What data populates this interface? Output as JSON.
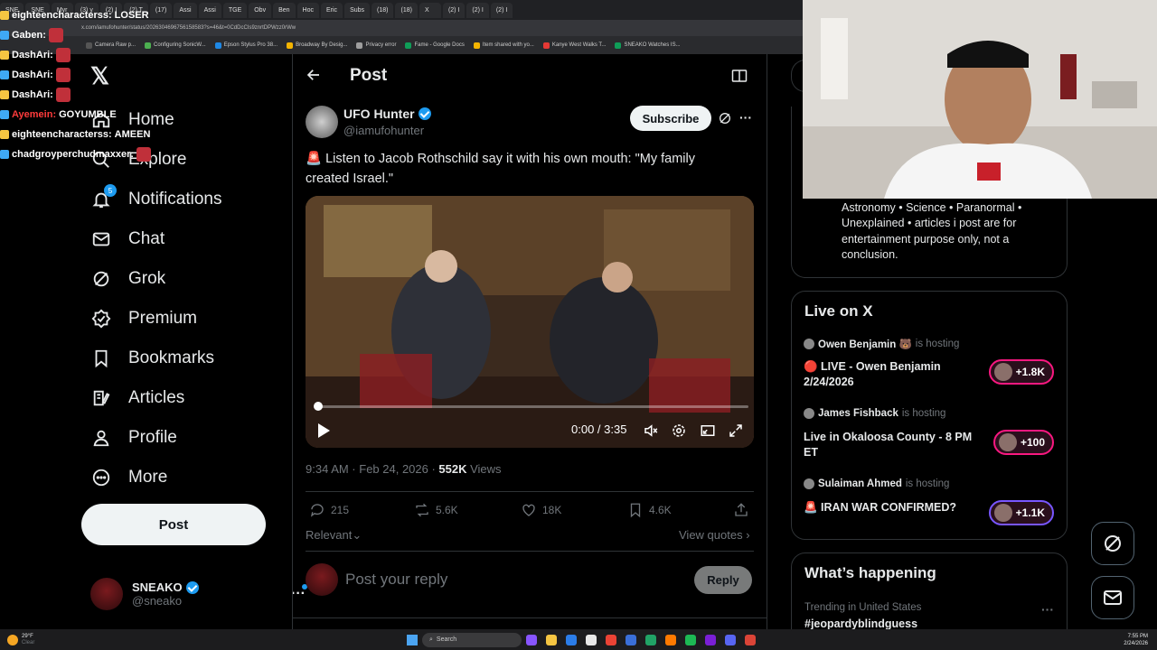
{
  "browser": {
    "tabs": [
      "SNE",
      "SNE",
      "Myr",
      "(3) y",
      "(2) I",
      "(2) T",
      "(17)",
      "Assi",
      "Assi",
      "TGE",
      "Obv",
      "Ben",
      "Hoc",
      "Eric",
      "Subs",
      "(18)",
      "(18)",
      "X",
      "(2) I",
      "(2) I",
      "(2) I"
    ],
    "url": "x.com/iamufohunter/status/2026304696756158583?s=46&t=0CdDcCIs9znrtDPWzz0rWw",
    "bookmarks": [
      "Camera Raw p...",
      "Configuring SonicW...",
      "Epson Stylus Pro 38...",
      "Broadway By Desig...",
      "Privacy error",
      "Fame - Google Docs",
      "Item shared with yo...",
      "Kanye West Walks T...",
      "SNEAKO Watches IS..."
    ]
  },
  "chat": [
    {
      "user": "eighteencharacterss:",
      "msg": "LOSER",
      "user_color": "#ffffff"
    },
    {
      "user": "Gaben:",
      "msg": "",
      "user_color": "#ffffff"
    },
    {
      "user": "DashAri:",
      "msg": "",
      "user_color": "#ffffff"
    },
    {
      "user": "DashAri:",
      "msg": "",
      "user_color": "#ffffff"
    },
    {
      "user": "DashAri:",
      "msg": "",
      "user_color": "#ffffff"
    },
    {
      "user": "Ayemein:",
      "msg": "GOYUMBLE",
      "user_color": "#ff3b3b"
    },
    {
      "user": "eighteencharacterss:",
      "msg": "AMEEN",
      "user_color": "#ffffff"
    },
    {
      "user": "chadgroyperchudmaxxer:",
      "msg": "",
      "user_color": "#ffffff"
    }
  ],
  "nav": {
    "items": [
      {
        "label": "Home",
        "icon": "home-icon"
      },
      {
        "label": "Explore",
        "icon": "search-icon"
      },
      {
        "label": "Notifications",
        "icon": "bell-icon",
        "badge": "5"
      },
      {
        "label": "Chat",
        "icon": "mail-icon"
      },
      {
        "label": "Grok",
        "icon": "grok-icon"
      },
      {
        "label": "Premium",
        "icon": "premium-icon"
      },
      {
        "label": "Bookmarks",
        "icon": "bookmark-icon"
      },
      {
        "label": "Articles",
        "icon": "article-icon"
      },
      {
        "label": "Profile",
        "icon": "person-icon"
      },
      {
        "label": "More",
        "icon": "more-icon"
      }
    ],
    "post_label": "Post",
    "account": {
      "name": "SNEAKO",
      "handle": "@sneako"
    }
  },
  "header": {
    "title": "Post"
  },
  "tweet": {
    "author": "UFO Hunter",
    "handle": "@iamufohunter",
    "subscribe_label": "Subscribe",
    "text": "🚨 Listen to Jacob Rothschild say it with his own mouth: \"My family created Israel.\"",
    "video_time": "0:00 / 3:35",
    "video_progress": 0.0,
    "timestamp": "9:34 AM · Feb 24, 2026 · ",
    "views": "552K",
    "views_label": " Views",
    "stats": {
      "replies": "215",
      "reposts": "5.6K",
      "likes": "18K",
      "bookmarks": "4.6K"
    },
    "sort_label": "Relevant",
    "view_quotes": "View quotes",
    "reply_placeholder": "Post your reply",
    "reply_button": "Reply"
  },
  "right": {
    "bio": "Conspiracy theories • sightings • Astronomy • Science • Paranormal • Unexplained • articles i post are for entertainment purpose only, not a conclusion.",
    "live_title": "Live on X",
    "live": [
      {
        "host": "Owen Benjamin 🐻",
        "hosting": "is hosting",
        "title": "🔴 LIVE - Owen Benjamin 2/24/2026",
        "count": "+1.8K",
        "pill_color": "#f91880"
      },
      {
        "host": "James Fishback",
        "hosting": "is hosting",
        "title": "Live in Okaloosa County - 8 PM ET",
        "count": "+100",
        "pill_color": "#f91880"
      },
      {
        "host": "Sulaiman Ahmed",
        "hosting": "is hosting",
        "title": "🚨 IRAN WAR CONFIRMED?",
        "count": "+1.1K",
        "pill_color": "#7856ff"
      }
    ],
    "happening_title": "What’s happening",
    "trend_context": "Trending in United States",
    "trend_name": "#jeopardyblindguess"
  },
  "taskbar": {
    "weather_temp": "29°F",
    "weather_desc": "Clear",
    "search": "Search",
    "time": "7:55 PM",
    "date": "2/24/2026"
  }
}
